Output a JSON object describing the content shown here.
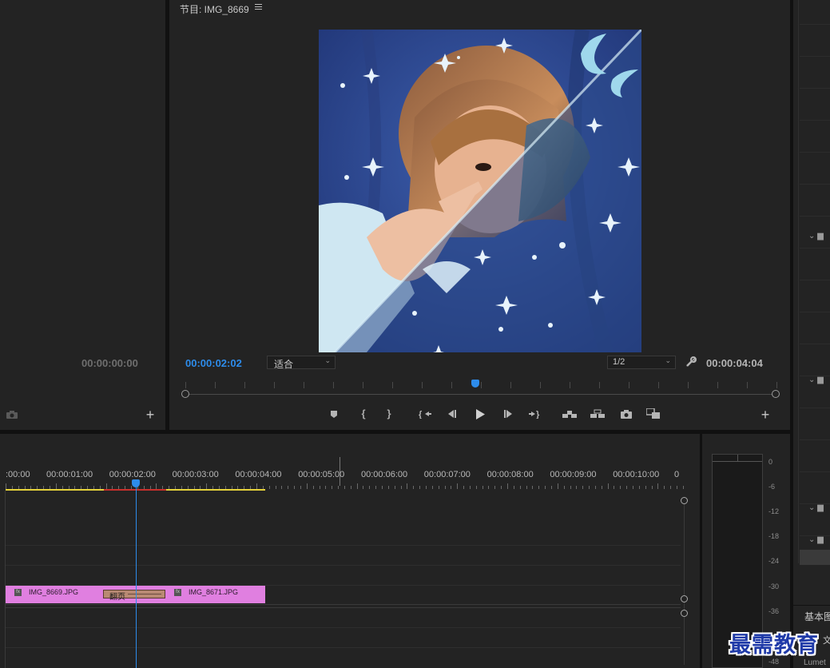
{
  "source_monitor": {
    "timecode": "00:00:00:00"
  },
  "program_monitor": {
    "title": "节目: IMG_8669",
    "menu_icon": "hamburger-icon",
    "current_timecode": "00:00:02:02",
    "fit_value": "适合",
    "resolution_value": "1/2",
    "duration_timecode": "00:00:04:04",
    "accent_color": "#2d8ceb",
    "playhead_fraction": 0.49
  },
  "transport": {
    "buttons": [
      {
        "name": "add-marker",
        "glyph": "⬟"
      },
      {
        "name": "mark-in",
        "glyph": "{"
      },
      {
        "name": "mark-out",
        "glyph": "}"
      },
      {
        "name": "go-to-in",
        "glyph": "{⇤"
      },
      {
        "name": "step-back",
        "glyph": "◀|"
      },
      {
        "name": "play",
        "glyph": "▶"
      },
      {
        "name": "step-forward",
        "glyph": "|▶"
      },
      {
        "name": "go-to-out",
        "glyph": "⇥}"
      },
      {
        "name": "lift",
        "glyph": "⏏"
      },
      {
        "name": "extract",
        "glyph": "⏏"
      },
      {
        "name": "export-frame",
        "glyph": "📷"
      },
      {
        "name": "comparison-view",
        "glyph": "⧉"
      }
    ]
  },
  "timeline": {
    "ruler_labels": [
      ":00:00",
      "00:00:01:00",
      "00:00:02:00",
      "00:00:03:00",
      "00:00:04:00",
      "00:00:05:00",
      "00:00:06:00",
      "00:00:07:00",
      "00:00:08:00",
      "00:00:09:00",
      "00:00:10:00",
      "0"
    ],
    "clips": [
      {
        "name": "IMG_8669.JPG",
        "fx": "fx"
      },
      {
        "name": "IMG_8671.JPG",
        "fx": "fx"
      }
    ],
    "transition_label": "翻页",
    "clip_color": "#e07fe0",
    "transition_color": "#b98a73"
  },
  "audio_meter": {
    "db_labels": [
      "0",
      "-6",
      "-12",
      "-18",
      "-24",
      "-30",
      "-36",
      "-48"
    ]
  },
  "right_panel": {
    "section_label": "基本图",
    "lumetri_label": "Lumet",
    "partial_label": "文本"
  },
  "watermark": "最需教育"
}
